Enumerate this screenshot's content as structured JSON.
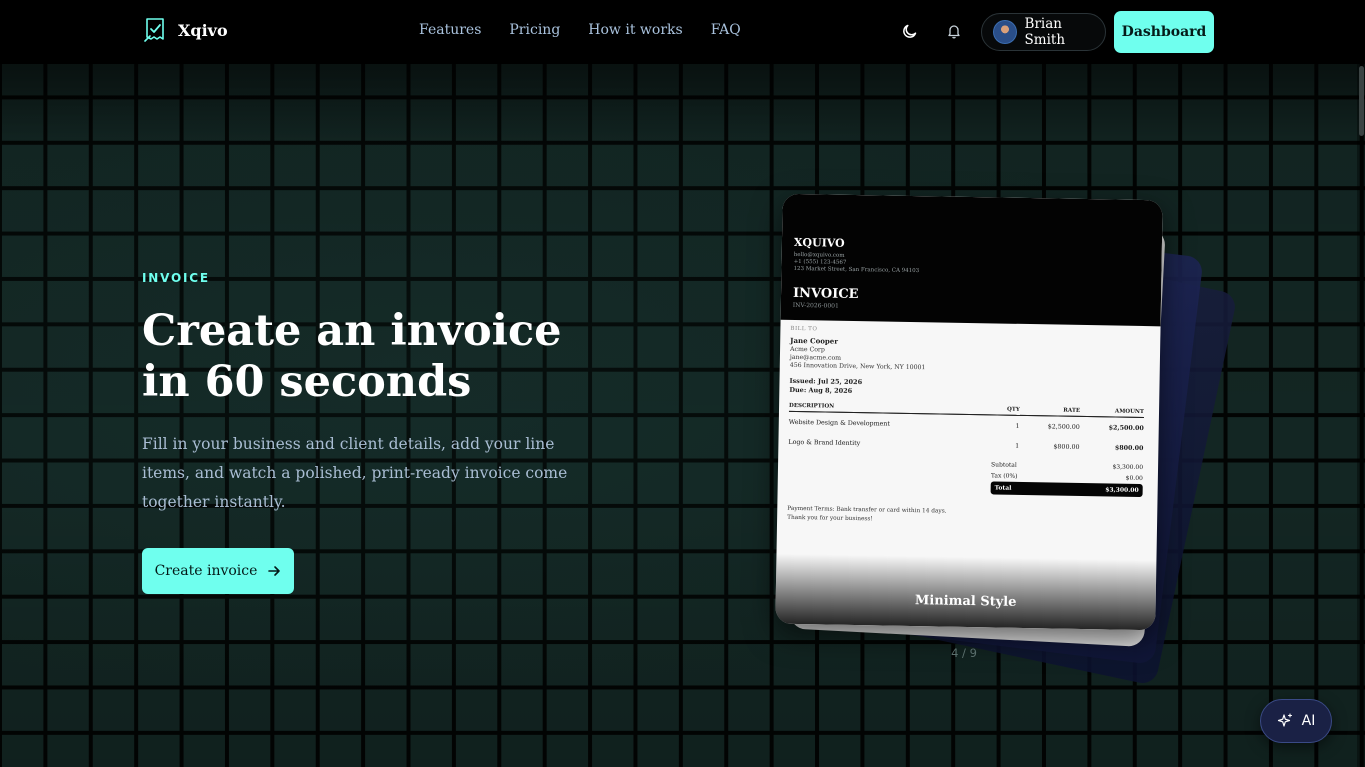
{
  "app": {
    "brand_name": "Xqivo",
    "accent_color": "#6fffee"
  },
  "header": {
    "nav": [
      {
        "label": "Features"
      },
      {
        "label": "Pricing"
      },
      {
        "label": "How it works"
      },
      {
        "label": "FAQ"
      }
    ],
    "theme_icon": "moon-icon",
    "notification_icon": "bell-icon",
    "user": {
      "name": "Brian Smith"
    },
    "dashboard_label": "Dashboard"
  },
  "hero": {
    "eyebrow": "INVOICE",
    "title_line1": "Create an invoice",
    "title_line2": "in 60 seconds",
    "description": "Fill in your business and client details, add your line items, and watch a polished, print-ready invoice come together instantly.",
    "cta_label": "Create invoice"
  },
  "preview": {
    "company": "XQUIVO",
    "company_email": "hello@xquivo.com",
    "company_phone": "+1 (555) 123-4567",
    "company_address": "123 Market Street, San Francisco, CA 94103",
    "doc_title": "INVOICE",
    "doc_number": "INV-2026-0001",
    "bill_to_label": "BILL TO",
    "client_name": "Jane Cooper",
    "client_company": "Acme Corp",
    "client_email": "jane@acme.com",
    "client_address": "456 Innovation Drive, New York, NY 10001",
    "issued": "Issued: Jul 25, 2026",
    "due": "Due: Aug 8, 2026",
    "columns": {
      "description": "DESCRIPTION",
      "qty": "QTY",
      "rate": "RATE",
      "amount": "AMOUNT"
    },
    "items": [
      {
        "description": "Website Design & Development",
        "qty": "1",
        "rate": "$2,500.00",
        "amount": "$2,500.00"
      },
      {
        "description": "Logo & Brand Identity",
        "qty": "1",
        "rate": "$800.00",
        "amount": "$800.00"
      }
    ],
    "subtotal_label": "Subtotal",
    "subtotal_value": "$3,300.00",
    "tax_label": "Tax (0%)",
    "tax_value": "$0.00",
    "total_label": "Total",
    "total_value": "$3,300.00",
    "terms": "Payment Terms: Bank transfer or card within 14 days.",
    "thanks": "Thank you for your business!",
    "style_name": "Minimal Style",
    "pager": "4 / 9"
  },
  "assistant": {
    "label": "AI",
    "icon": "sparkle-icon"
  }
}
